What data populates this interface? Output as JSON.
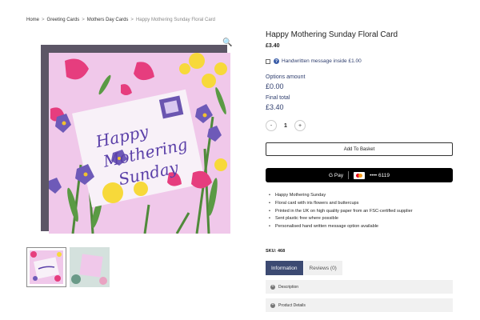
{
  "breadcrumb": {
    "items": [
      "Home",
      "Greeting Cards",
      "Mothers Day Cards"
    ],
    "separator": ">",
    "current": "Happy Mothering Sunday Floral Card"
  },
  "card_art": {
    "line1": "Happy",
    "line2": "Mothering",
    "line3": "Sunday"
  },
  "product": {
    "title": "Happy Mothering Sunday Floral Card",
    "price": "£3.40",
    "handwritten_option": "Handwritten message inside £1.00",
    "options_amount_label": "Options amount",
    "options_amount_value": "£0.00",
    "final_total_label": "Final total",
    "final_total_value": "£3.40",
    "quantity": "1",
    "minus": "-",
    "plus": "+",
    "add_to_basket": "Add To Basket",
    "gpay_label": "G Pay",
    "card_last4": "•••• 6119",
    "bullets": [
      "Happy Mothering Sunday",
      "Floral card with iris flowers and buttercups",
      "Printed in the UK on high quality paper from an FSC-certified supplier",
      "Sent plastic free where possible",
      "Personalised hand written message option available"
    ],
    "sku": "SKU: 468"
  },
  "tabs": [
    {
      "label": "Information",
      "active": true
    },
    {
      "label": "Reviews (0)",
      "active": false
    }
  ],
  "accordion": [
    {
      "label": "Description"
    },
    {
      "label": "Product Details"
    }
  ],
  "colors": {
    "accent": "#2f3e6e",
    "tab_active": "#3c4a72",
    "card_bg": "#f0c8ea",
    "gpay_bg": "#000000"
  }
}
